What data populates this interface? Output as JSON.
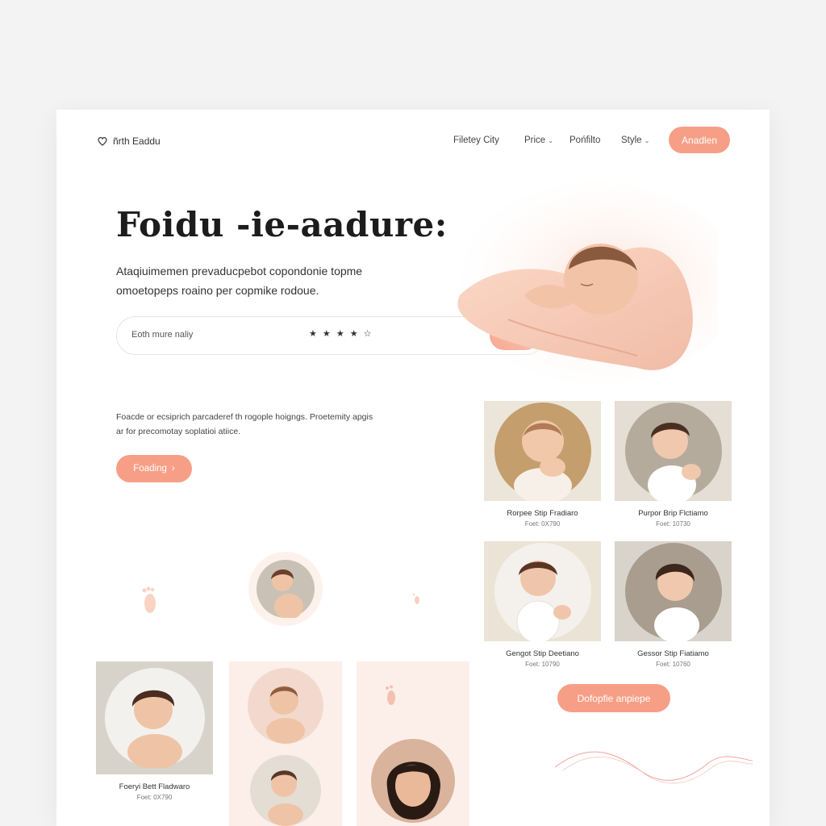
{
  "header": {
    "logo_text": "ñrth Eaddu",
    "nav": [
      {
        "label": "Filetey City",
        "has_dropdown": false
      },
      {
        "label": "Price",
        "has_dropdown": true
      },
      {
        "label": "Pońfilto",
        "has_dropdown": false
      },
      {
        "label": "Style",
        "has_dropdown": true
      }
    ],
    "cta_label": "Anadlen"
  },
  "hero": {
    "title": "Foidu -ie-aadure:",
    "subtitle": "Ataqiuimemen prevaducpebot copondonie topme omoetopeps roaino per copmike rodoue.",
    "search_placeholder": "Eoth mure naliy",
    "rating": "★ ★ ★ ★ ☆",
    "search_button_icon": "search-icon"
  },
  "intro": {
    "text": "Foacde or ecsiprich parcaderef th rogople hoigngs. Proetemity apgis ar for precomotay soplatioi atiice.",
    "button_label": "Foading",
    "button_arrow": "›"
  },
  "products": [
    {
      "name": "Rorpee Stip Fradiaro",
      "price": "Foet: 0X790"
    },
    {
      "name": "Purpor Brip Flctiamo",
      "price": "Foet: 10730"
    },
    {
      "name": "Gengot Stip Deetiano",
      "price": "Foet: 10790"
    },
    {
      "name": "Gessor Stip Fiatiamo",
      "price": "Foet: 10760"
    }
  ],
  "more_button_label": "Dofopfie anpiepe",
  "bottom_card": {
    "name": "Foeryi Bett Fladwaro",
    "price": "Foet: 0X790"
  },
  "colors": {
    "accent": "#f79f86",
    "card_bg": "#ece6da",
    "panel_bg": "#fcefea",
    "page_bg": "#f3f3f3"
  }
}
